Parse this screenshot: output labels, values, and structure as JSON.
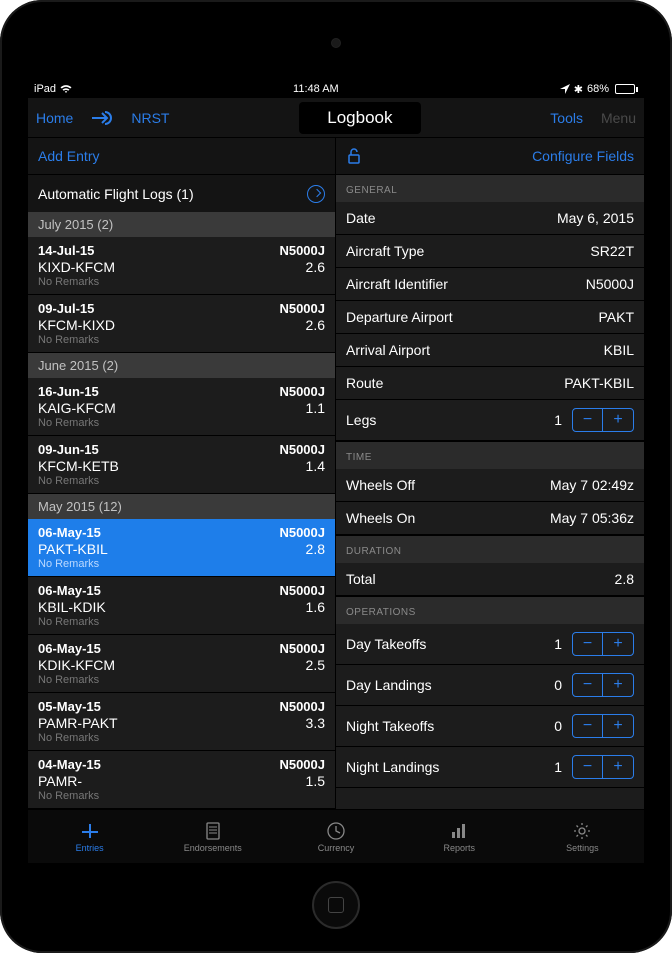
{
  "statusBar": {
    "device": "iPad",
    "time": "11:48 AM",
    "bt": "68%"
  },
  "nav": {
    "home": "Home",
    "nrst": "NRST",
    "title": "Logbook",
    "tools": "Tools",
    "menu": "Menu"
  },
  "leftBar": {
    "addEntry": "Add Entry",
    "autoLogs": "Automatic Flight Logs (1)"
  },
  "rightBar": {
    "configure": "Configure Fields"
  },
  "groups": [
    {
      "title": "July 2015 (2)",
      "entries": [
        {
          "date": "14-Jul-15",
          "tail": "N5000J",
          "route": "KIXD-KFCM",
          "hours": "2.6",
          "remarks": "No Remarks",
          "sel": false
        },
        {
          "date": "09-Jul-15",
          "tail": "N5000J",
          "route": "KFCM-KIXD",
          "hours": "2.6",
          "remarks": "No Remarks",
          "sel": false
        }
      ]
    },
    {
      "title": "June 2015 (2)",
      "entries": [
        {
          "date": "16-Jun-15",
          "tail": "N5000J",
          "route": "KAIG-KFCM",
          "hours": "1.1",
          "remarks": "No Remarks",
          "sel": false
        },
        {
          "date": "09-Jun-15",
          "tail": "N5000J",
          "route": "KFCM-KETB",
          "hours": "1.4",
          "remarks": "No Remarks",
          "sel": false
        }
      ]
    },
    {
      "title": "May 2015 (12)",
      "entries": [
        {
          "date": "06-May-15",
          "tail": "N5000J",
          "route": "PAKT-KBIL",
          "hours": "2.8",
          "remarks": "No Remarks",
          "sel": true
        },
        {
          "date": "06-May-15",
          "tail": "N5000J",
          "route": "KBIL-KDIK",
          "hours": "1.6",
          "remarks": "No Remarks",
          "sel": false
        },
        {
          "date": "06-May-15",
          "tail": "N5000J",
          "route": "KDIK-KFCM",
          "hours": "2.5",
          "remarks": "No Remarks",
          "sel": false
        },
        {
          "date": "05-May-15",
          "tail": "N5000J",
          "route": "PAMR-PAKT",
          "hours": "3.3",
          "remarks": "No Remarks",
          "sel": false
        },
        {
          "date": "04-May-15",
          "tail": "N5000J",
          "route": "PAMR-",
          "hours": "1.5",
          "remarks": "No Remarks",
          "sel": false
        }
      ]
    }
  ],
  "sections": {
    "general": {
      "hdr": "GENERAL",
      "rows": [
        {
          "label": "Date",
          "value": "May 6, 2015"
        },
        {
          "label": "Aircraft Type",
          "value": "SR22T"
        },
        {
          "label": "Aircraft Identifier",
          "value": "N5000J"
        },
        {
          "label": "Departure Airport",
          "value": "PAKT"
        },
        {
          "label": "Arrival Airport",
          "value": "KBIL"
        },
        {
          "label": "Route",
          "value": "PAKT-KBIL"
        }
      ],
      "legs": {
        "label": "Legs",
        "value": "1"
      }
    },
    "time": {
      "hdr": "TIME",
      "rows": [
        {
          "label": "Wheels Off",
          "value": "May 7  02:49z"
        },
        {
          "label": "Wheels On",
          "value": "May 7  05:36z"
        }
      ]
    },
    "duration": {
      "hdr": "DURATION",
      "rows": [
        {
          "label": "Total",
          "value": "2.8"
        }
      ]
    },
    "ops": {
      "hdr": "OPERATIONS",
      "rows": [
        {
          "label": "Day Takeoffs",
          "value": "1"
        },
        {
          "label": "Day Landings",
          "value": "0"
        },
        {
          "label": "Night Takeoffs",
          "value": "0"
        },
        {
          "label": "Night Landings",
          "value": "1"
        }
      ]
    }
  },
  "tabs": [
    {
      "label": "Entries",
      "active": true
    },
    {
      "label": "Endorsements",
      "active": false
    },
    {
      "label": "Currency",
      "active": false
    },
    {
      "label": "Reports",
      "active": false
    },
    {
      "label": "Settings",
      "active": false
    }
  ]
}
